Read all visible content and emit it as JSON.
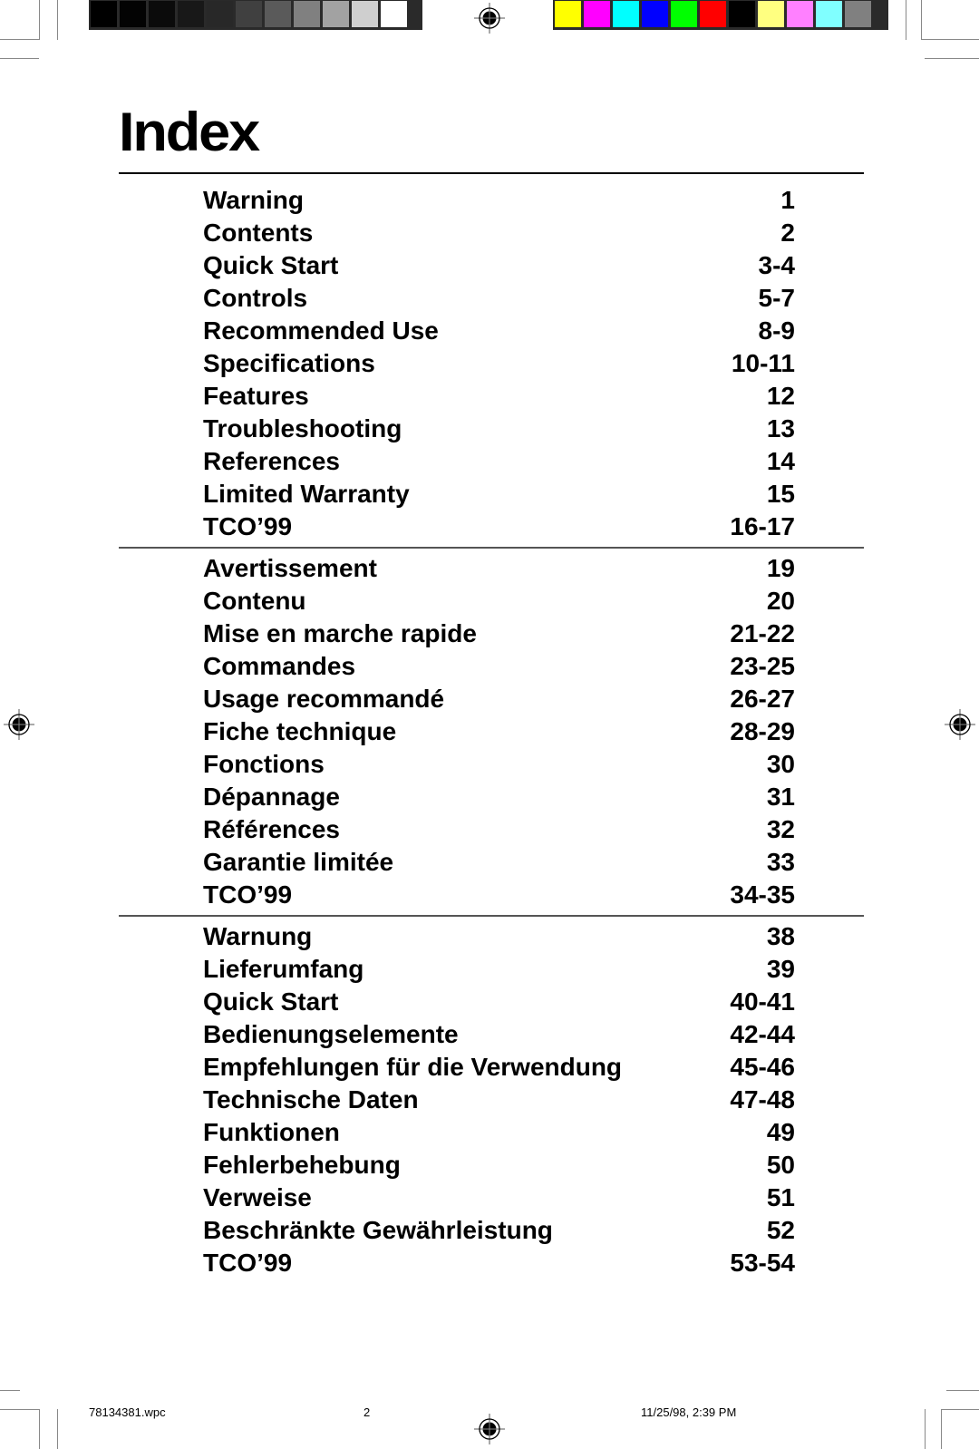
{
  "page": {
    "title": "Index",
    "sections": [
      {
        "language": "English",
        "entries": [
          {
            "label": "Warning",
            "page": "1"
          },
          {
            "label": "Contents",
            "page": "2"
          },
          {
            "label": "Quick Start",
            "page": "3-4"
          },
          {
            "label": "Controls",
            "page": "5-7"
          },
          {
            "label": "Recommended Use",
            "page": "8-9"
          },
          {
            "label": "Specifications",
            "page": "10-11"
          },
          {
            "label": "Features",
            "page": "12"
          },
          {
            "label": "Troubleshooting",
            "page": "13"
          },
          {
            "label": "References",
            "page": "14"
          },
          {
            "label": "Limited Warranty",
            "page": "15"
          },
          {
            "label": "TCO’99",
            "page": "16-17"
          }
        ]
      },
      {
        "language": "French",
        "entries": [
          {
            "label": "Avertissement",
            "page": "19"
          },
          {
            "label": "Contenu",
            "page": "20"
          },
          {
            "label": "Mise en marche rapide",
            "page": "21-22"
          },
          {
            "label": "Commandes",
            "page": "23-25"
          },
          {
            "label": "Usage recommandé",
            "page": "26-27"
          },
          {
            "label": "Fiche technique",
            "page": "28-29"
          },
          {
            "label": "Fonctions",
            "page": "30"
          },
          {
            "label": "Dépannage",
            "page": "31"
          },
          {
            "label": "Références",
            "page": "32"
          },
          {
            "label": "Garantie limitée",
            "page": "33"
          },
          {
            "label": "TCO’99",
            "page": "34-35"
          }
        ]
      },
      {
        "language": "German",
        "entries": [
          {
            "label": "Warnung",
            "page": "38"
          },
          {
            "label": "Lieferumfang",
            "page": "39"
          },
          {
            "label": "Quick Start",
            "page": "40-41"
          },
          {
            "label": "Bedienungselemente",
            "page": "42-44"
          },
          {
            "label": "Empfehlungen für die Verwendung",
            "page": "45-46"
          },
          {
            "label": "Technische Daten",
            "page": "47-48"
          },
          {
            "label": "Funktionen",
            "page": "49"
          },
          {
            "label": "Fehlerbehebung",
            "page": "50"
          },
          {
            "label": "Verweise",
            "page": "51"
          },
          {
            "label": "Beschränkte Gewährleistung",
            "page": "52"
          },
          {
            "label": "TCO’99",
            "page": "53-54"
          }
        ]
      }
    ]
  },
  "print_marks": {
    "gray_swatches": [
      "#000000",
      "#030303",
      "#0b0b0b",
      "#181818",
      "#282828",
      "#404040",
      "#5a5a5a",
      "#808080",
      "#a2a2a2",
      "#cfcfcf",
      "#ffffff"
    ],
    "color_swatches": [
      "#ffff00",
      "#ff00ff",
      "#00ffff",
      "#0000ff",
      "#00ff00",
      "#ff0000",
      "#000000",
      "#ffff80",
      "#ff80ff",
      "#80ffff",
      "#808080"
    ]
  },
  "footer": {
    "filename": "78134381.wpc",
    "page_number": "2",
    "timestamp": "11/25/98, 2:39 PM"
  }
}
